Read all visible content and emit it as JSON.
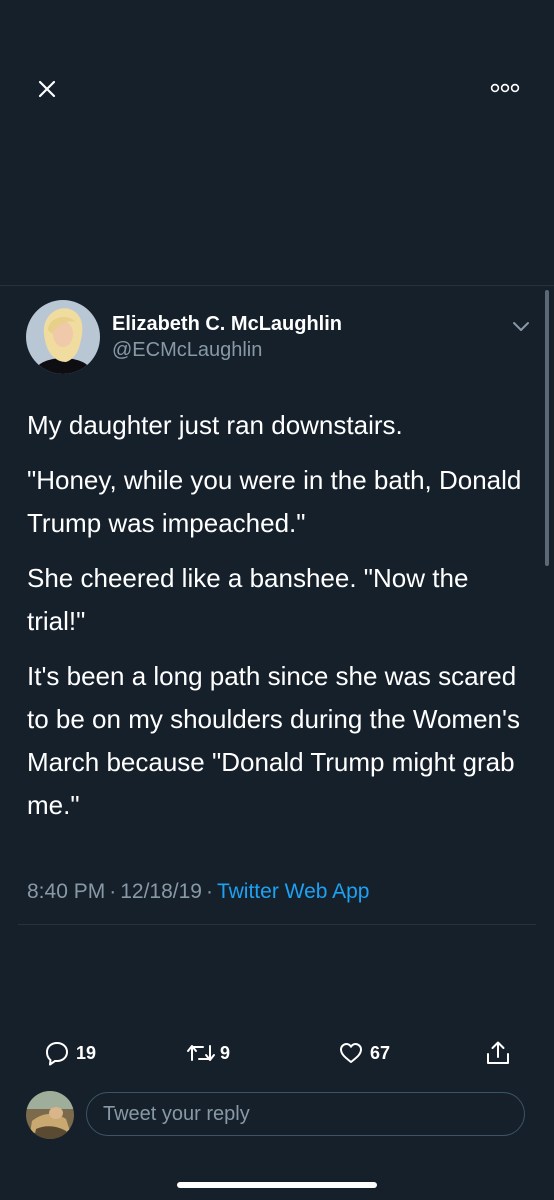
{
  "header": {
    "close_icon": "close-icon",
    "more_icon": "more-options-icon"
  },
  "tweet": {
    "author": {
      "name": "Elizabeth C. McLaughlin",
      "handle": "@ECMcLaughlin"
    },
    "paragraphs": [
      "My daughter just ran downstairs.",
      "\"Honey, while you were in the bath, Donald Trump was impeached.\"",
      "She cheered like a banshee. \"Now the trial!\"",
      "It's been a long path since she was scared to be on my shoulders during the Women's March because \"Donald Trump might grab me.\""
    ],
    "time": "8:40 PM",
    "date": "12/18/19",
    "separator": "·",
    "source": "Twitter Web App"
  },
  "actions": {
    "reply_count": "19",
    "retweet_count": "9",
    "like_count": "67"
  },
  "reply": {
    "placeholder": "Tweet your reply"
  },
  "colors": {
    "background": "#15202b",
    "accent": "#1da1f2",
    "secondary_text": "#8899a6",
    "divider": "#253341"
  }
}
